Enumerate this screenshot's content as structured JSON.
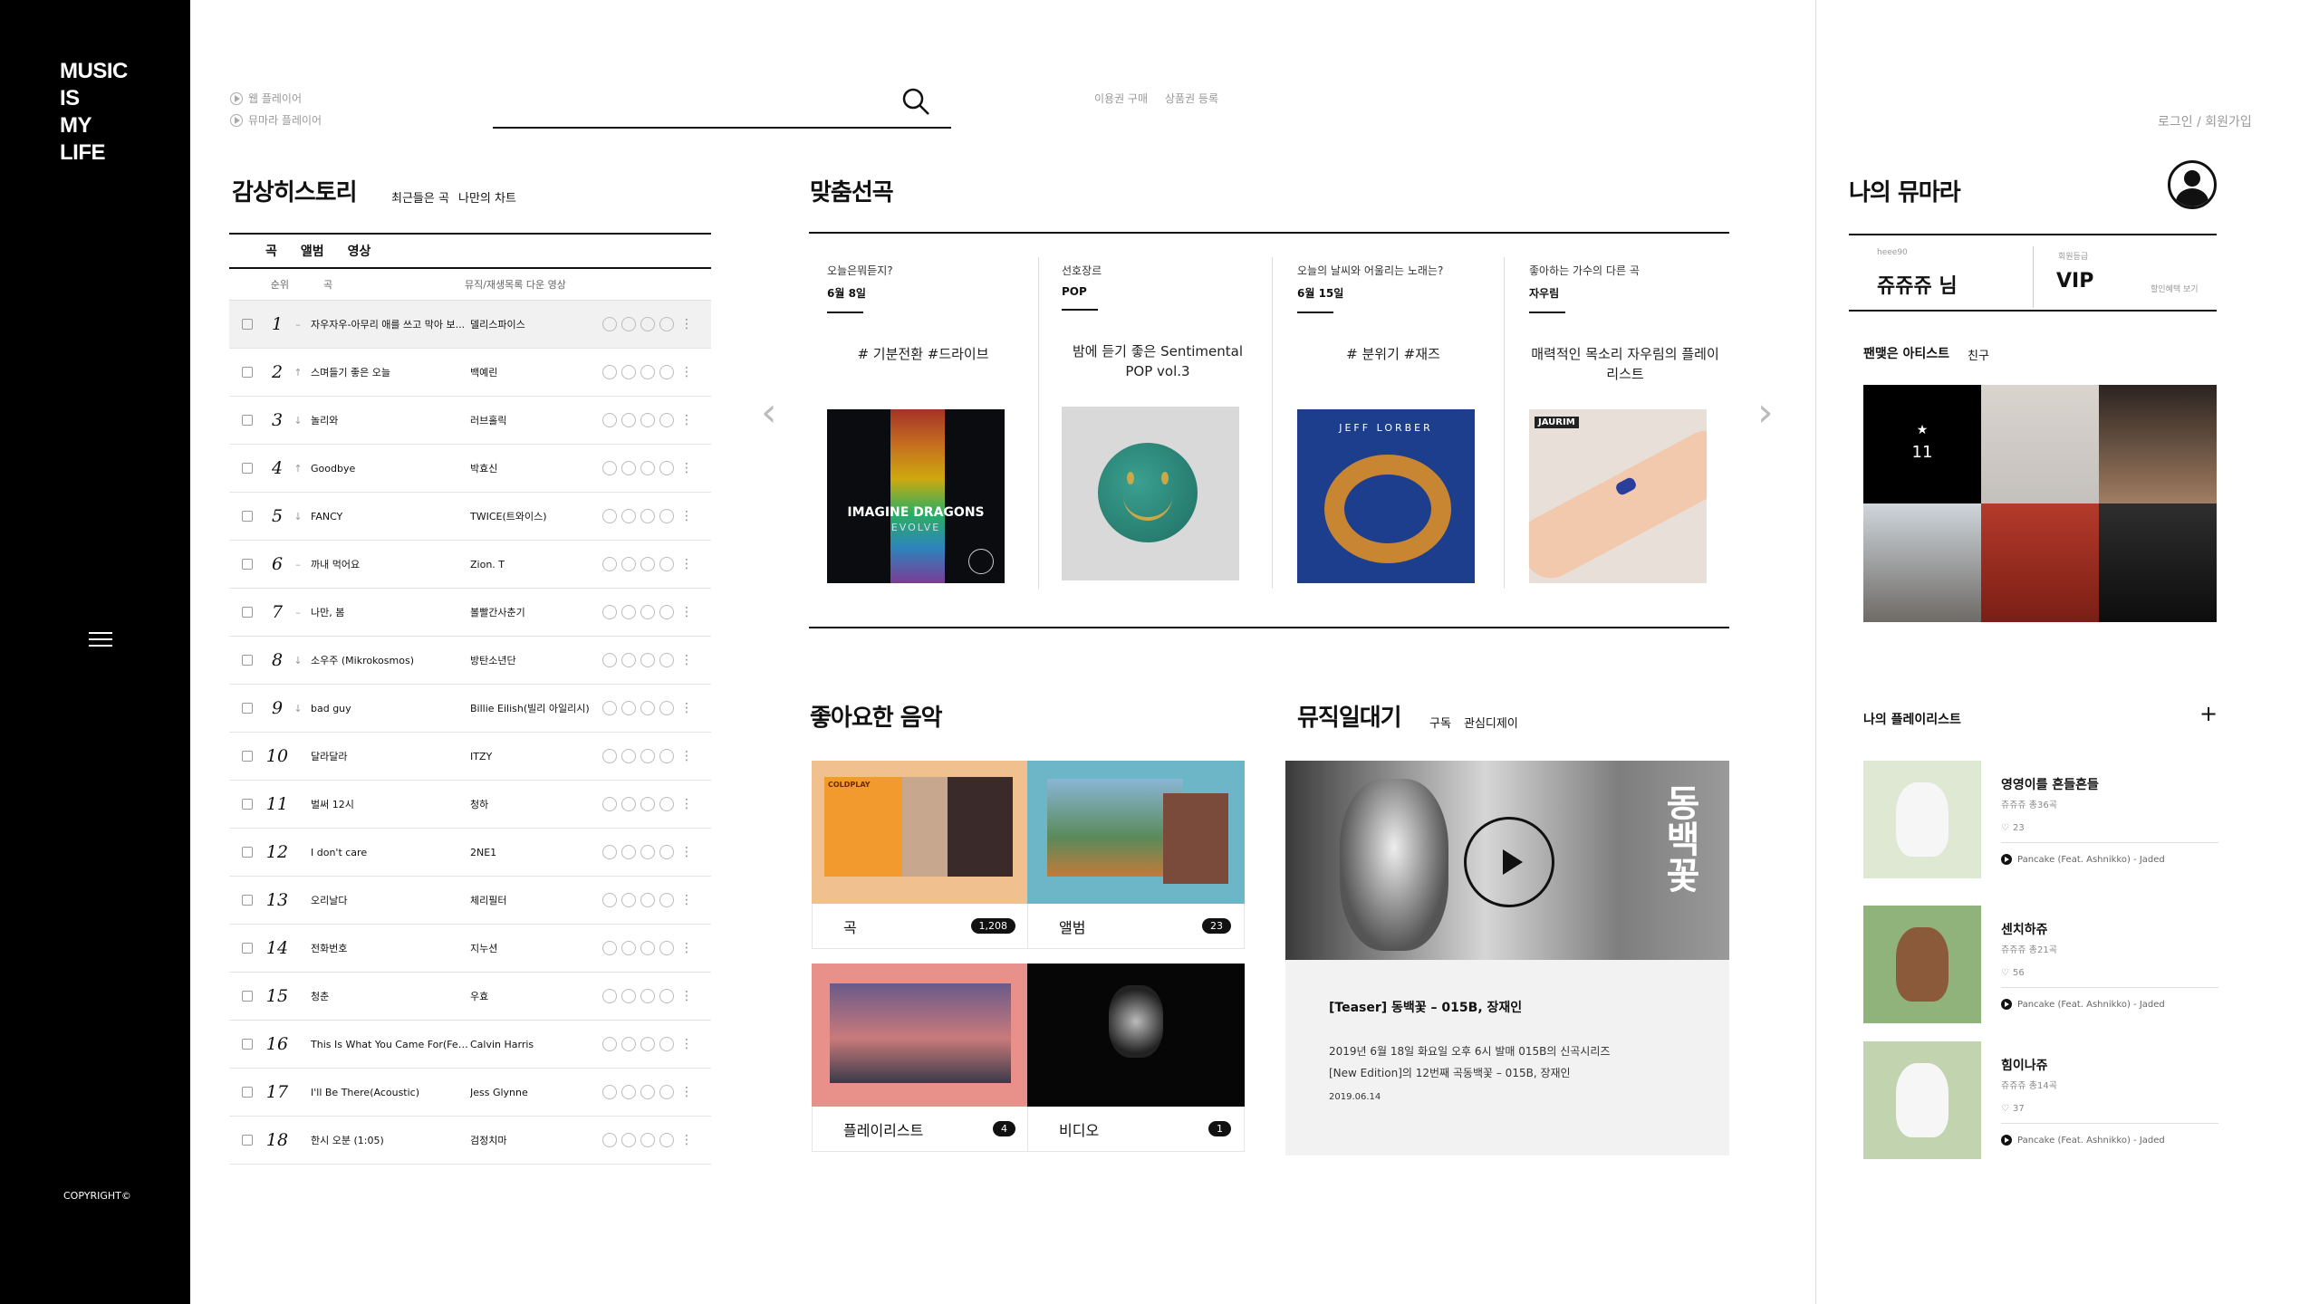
{
  "sidebar": {
    "logo": [
      "MUSIC",
      "IS",
      "MY",
      "LIFE"
    ],
    "copyright": "COPYRIGHT©"
  },
  "top": {
    "web_player": "웹 플레이어",
    "mumara_player": "뮤마라 플레이어",
    "buy_ticket": "이용권 구매",
    "product_register": "상품권 등록",
    "login": "로그인 / 회원가입"
  },
  "history": {
    "title": "감상히스토리",
    "tabs": [
      "최근들은 곡",
      "나만의 차트"
    ],
    "type_tabs": [
      "곡",
      "앨범",
      "영상"
    ],
    "col_rank": "순위",
    "col_song": "곡",
    "col_artist": "뮤직/재생목록 다운 영상",
    "rows": [
      {
        "rank": "1",
        "trend": "–",
        "song": "자우자우-아무리 애를 쓰고 막아 보...",
        "artist": "델리스파이스"
      },
      {
        "rank": "2",
        "trend": "↑",
        "song": "스며들기 좋은 오늘",
        "artist": "백예린"
      },
      {
        "rank": "3",
        "trend": "↓",
        "song": "놀리와",
        "artist": "러브홀릭"
      },
      {
        "rank": "4",
        "trend": "↑",
        "song": "Goodbye",
        "artist": "박효신"
      },
      {
        "rank": "5",
        "trend": "↓",
        "song": "FANCY",
        "artist": "TWICE(트와이스)"
      },
      {
        "rank": "6",
        "trend": "–",
        "song": "까내 먹어요",
        "artist": "Zion. T"
      },
      {
        "rank": "7",
        "trend": "–",
        "song": "나만, 봄",
        "artist": "볼빨간사춘기"
      },
      {
        "rank": "8",
        "trend": "↓",
        "song": "소우주 (Mikrokosmos)",
        "artist": "방탄소년단"
      },
      {
        "rank": "9",
        "trend": "↓",
        "song": "bad guy",
        "artist": "Billie Eilish(빌리 아일리시)"
      },
      {
        "rank": "10",
        "trend": "",
        "song": "달라달라",
        "artist": "ITZY"
      },
      {
        "rank": "11",
        "trend": "",
        "song": "벌써 12시",
        "artist": "청하"
      },
      {
        "rank": "12",
        "trend": "",
        "song": "I don't care",
        "artist": "2NE1"
      },
      {
        "rank": "13",
        "trend": "",
        "song": "오리날다",
        "artist": "체리필터"
      },
      {
        "rank": "14",
        "trend": "",
        "song": "전화번호",
        "artist": "지누션"
      },
      {
        "rank": "15",
        "trend": "",
        "song": "청춘",
        "artist": "우효"
      },
      {
        "rank": "16",
        "trend": "",
        "song": "This Is What You Came For(Fea...",
        "artist": "Calvin Harris"
      },
      {
        "rank": "17",
        "trend": "",
        "song": "I'll Be There(Acoustic)",
        "artist": "Jess Glynne"
      },
      {
        "rank": "18",
        "trend": "",
        "song": "한시 오분 (1:05)",
        "artist": "검정치마"
      }
    ]
  },
  "reco": {
    "title": "맞춤선곡",
    "cards": [
      {
        "q": "오늘은뭐듣지?",
        "d": "6월 8일",
        "tags": "# 기분전환    #드라이브",
        "cover_text": "IMAGINE DRAGONS",
        "cover_sub": "EVOLVE"
      },
      {
        "q": "선호장르",
        "d": "POP",
        "tags": "밤에 듣기 좋은 Sentimental POP vol.3"
      },
      {
        "q": "오늘의 날씨와 어울리는 노래는?",
        "d": "6월 15일",
        "tags": "# 분위기    #재즈",
        "cover_text": "JEFF LORBER"
      },
      {
        "q": "좋아하는 가수의 다른 곡",
        "d": "자우림",
        "tags": "매력적인 목소리 자우림의 플레이리스트",
        "cover_text": "JAURIM"
      }
    ]
  },
  "liked": {
    "title": "좋아요한 음악",
    "tiles": [
      {
        "label": "곡",
        "count": "1,208",
        "art_text": "COLDPLAY"
      },
      {
        "label": "앨범",
        "count": "23"
      },
      {
        "label": "플레이리스트",
        "count": "4"
      },
      {
        "label": "비디오",
        "count": "1"
      }
    ]
  },
  "diary": {
    "title": "뮤직일대기",
    "tabs": [
      "구독",
      "관심디제이"
    ],
    "overlay_text": "동백꽃",
    "video_title": "[Teaser] 동백꽃 – 015B, 장재인",
    "desc1": "2019년 6월 18일 화요일 오후 6시 발매 015B의 신곡시리즈",
    "desc2": "[New Edition]의 12번째 곡동백꽃 – 015B, 장재인",
    "date": "2019.06.14"
  },
  "my": {
    "title": "나의 뮤마라",
    "user_id": "heee90",
    "user_name": "쥬쥬쥬 님",
    "grade_label": "회원등급",
    "grade": "VIP",
    "grade_link": "할인혜택 보기",
    "fav_title": "팬맺은 아티스트",
    "fav_friend": "친구",
    "fav_count": "11",
    "playlist_title": "나의 플레이리스트",
    "playlists": [
      {
        "name": "영영이를 흔들흔들",
        "meta": "쥬쥬쥬    총36곡",
        "likes": "23",
        "song": "Pancake (Feat. Ashnikko) - Jaded"
      },
      {
        "name": "센치하쥬",
        "meta": "쥬쥬쥬    총21곡",
        "likes": "56",
        "song": "Pancake (Feat. Ashnikko) - Jaded"
      },
      {
        "name": "힘이나쥬",
        "meta": "쥬쥬쥬    총14곡",
        "likes": "37",
        "song": "Pancake (Feat. Ashnikko) - Jaded"
      }
    ]
  }
}
